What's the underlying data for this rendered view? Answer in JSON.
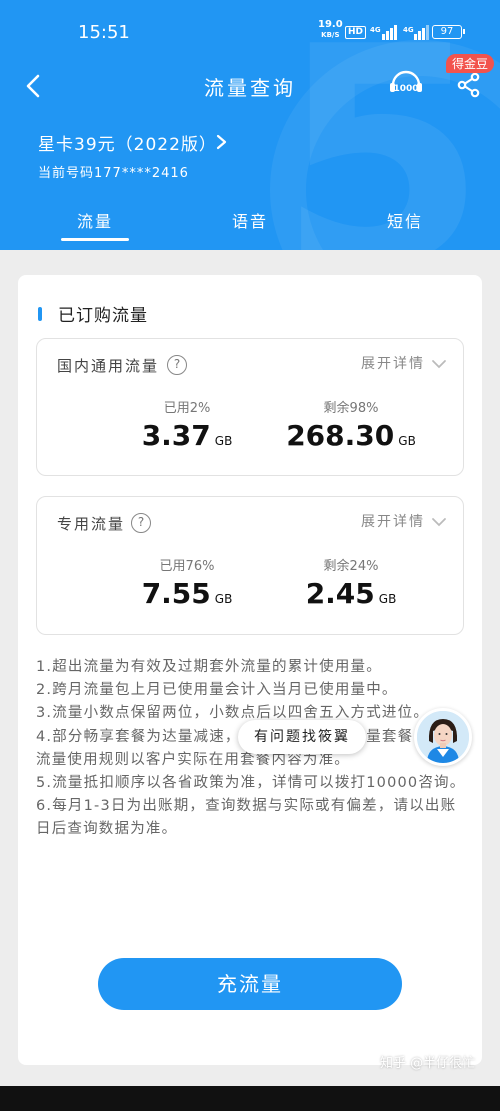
{
  "status_bar": {
    "time": "15:51",
    "speed_value": "19.0",
    "speed_unit": "KB/S",
    "hd": "HD",
    "battery": "97"
  },
  "nav": {
    "title": "流量查询",
    "badge": "得金豆",
    "icon_1000": "1000"
  },
  "plan": {
    "name": "星卡39元（2022版）",
    "number": "当前号码177****2416"
  },
  "tabs": [
    {
      "label": "流量"
    },
    {
      "label": "语音"
    },
    {
      "label": "短信"
    }
  ],
  "section_title": "已订购流量",
  "cards": [
    {
      "title": "国内通用流量",
      "expand": "展开详情",
      "used_label": "已用2%",
      "remaining_label": "剩余98%",
      "used_value": "3.37",
      "remaining_value": "268.30",
      "unit": "GB"
    },
    {
      "title": "专用流量",
      "expand": "展开详情",
      "used_label": "已用76%",
      "remaining_label": "剩余24%",
      "used_value": "7.55",
      "remaining_value": "2.45",
      "unit": "GB"
    }
  ],
  "notes": [
    "1.超出流量为有效及过期套外流量的累计使用量。",
    "2.跨月流量包上月已使用量会计入当月已使用量中。",
    "3.流量小数点保留两位，小数点后以四舍五入方式进位。",
    "4.部分畅享套餐为达量减速，非畅享则为普通流量套餐，具体流量使用规则以客户实际在用套餐内容为准。",
    "5.流量抵扣顺序以各省政策为准，详情可以拨打10000咨询。",
    "6.每月1-3日为出账期，查询数据与实际或有偏差，请以出账日后查询数据为准。"
  ],
  "tooltip": "有问题找筱翼",
  "cta": "充流量",
  "watermark": "知乎 @半仔很忙"
}
